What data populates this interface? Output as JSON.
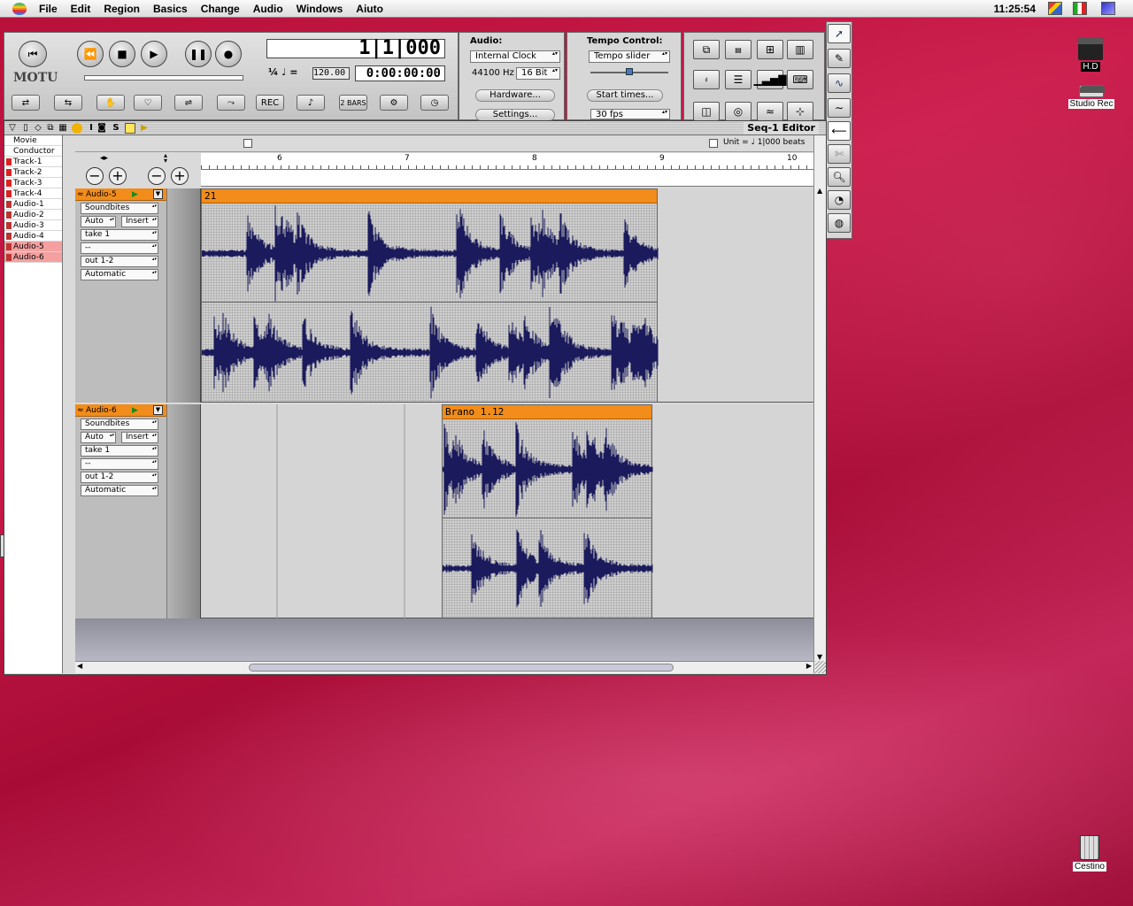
{
  "menubar": {
    "items": [
      "File",
      "Edit",
      "Region",
      "Basics",
      "Change",
      "Audio",
      "Windows",
      "Aiuto"
    ],
    "clock": "11:25:54"
  },
  "desktop": {
    "hd_label": "H.D",
    "studio_label": "Studio Rec",
    "trash_label": "Cestino"
  },
  "transport": {
    "brand": "MOTU",
    "counter": "1|1|000",
    "time": "0:00:00:00",
    "tempo": "120.00",
    "audio_label": "Audio:",
    "clock_source": "Internal Clock",
    "sample_rate": "44100 Hz",
    "bit_depth": "16 Bit",
    "hardware_btn": "Hardware...",
    "settings_btn": "Settings...",
    "tempo_label": "Tempo Control:",
    "tempo_mode": "Tempo slider",
    "start_times_btn": "Start times...",
    "fps": "30 fps",
    "rec_label": "REC",
    "bars_label": "2 BARS"
  },
  "editor": {
    "title": "Seq-1 Editor",
    "unit_label": "Unit = ♩ 1|000 beats",
    "ruler_ticks": [
      "6",
      "7",
      "8",
      "9",
      "10"
    ],
    "tracklist": [
      {
        "name": "Movie",
        "kind": "movie",
        "selected": false
      },
      {
        "name": "Conductor",
        "kind": "conductor",
        "selected": false
      },
      {
        "name": "Track-1",
        "kind": "midi",
        "selected": false
      },
      {
        "name": "Track-2",
        "kind": "midi",
        "selected": false
      },
      {
        "name": "Track-3",
        "kind": "midi",
        "selected": false
      },
      {
        "name": "Track-4",
        "kind": "midi",
        "selected": false
      },
      {
        "name": "Audio-1",
        "kind": "audio",
        "selected": false
      },
      {
        "name": "Audio-2",
        "kind": "audio",
        "selected": false
      },
      {
        "name": "Audio-3",
        "kind": "audio",
        "selected": false
      },
      {
        "name": "Audio-4",
        "kind": "audio",
        "selected": false
      },
      {
        "name": "Audio-5",
        "kind": "audio",
        "selected": true
      },
      {
        "name": "Audio-6",
        "kind": "audio",
        "selected": true
      }
    ],
    "lanes": [
      {
        "name": "Audio-5",
        "fields": [
          "Soundbites",
          "Auto",
          "Insert",
          "take 1",
          "--",
          "out 1-2",
          "Automatic"
        ],
        "region_label": "21"
      },
      {
        "name": "Audio-6",
        "fields": [
          "Soundbites",
          "Auto",
          "Insert",
          "take 1",
          "--",
          "out 1-2",
          "Automatic"
        ],
        "region_label": "Brano  1.12"
      }
    ]
  },
  "colors": {
    "region_header": "#f28c1a",
    "waveform": "#1a1a5c",
    "selected_track": "#f5a0a0"
  }
}
